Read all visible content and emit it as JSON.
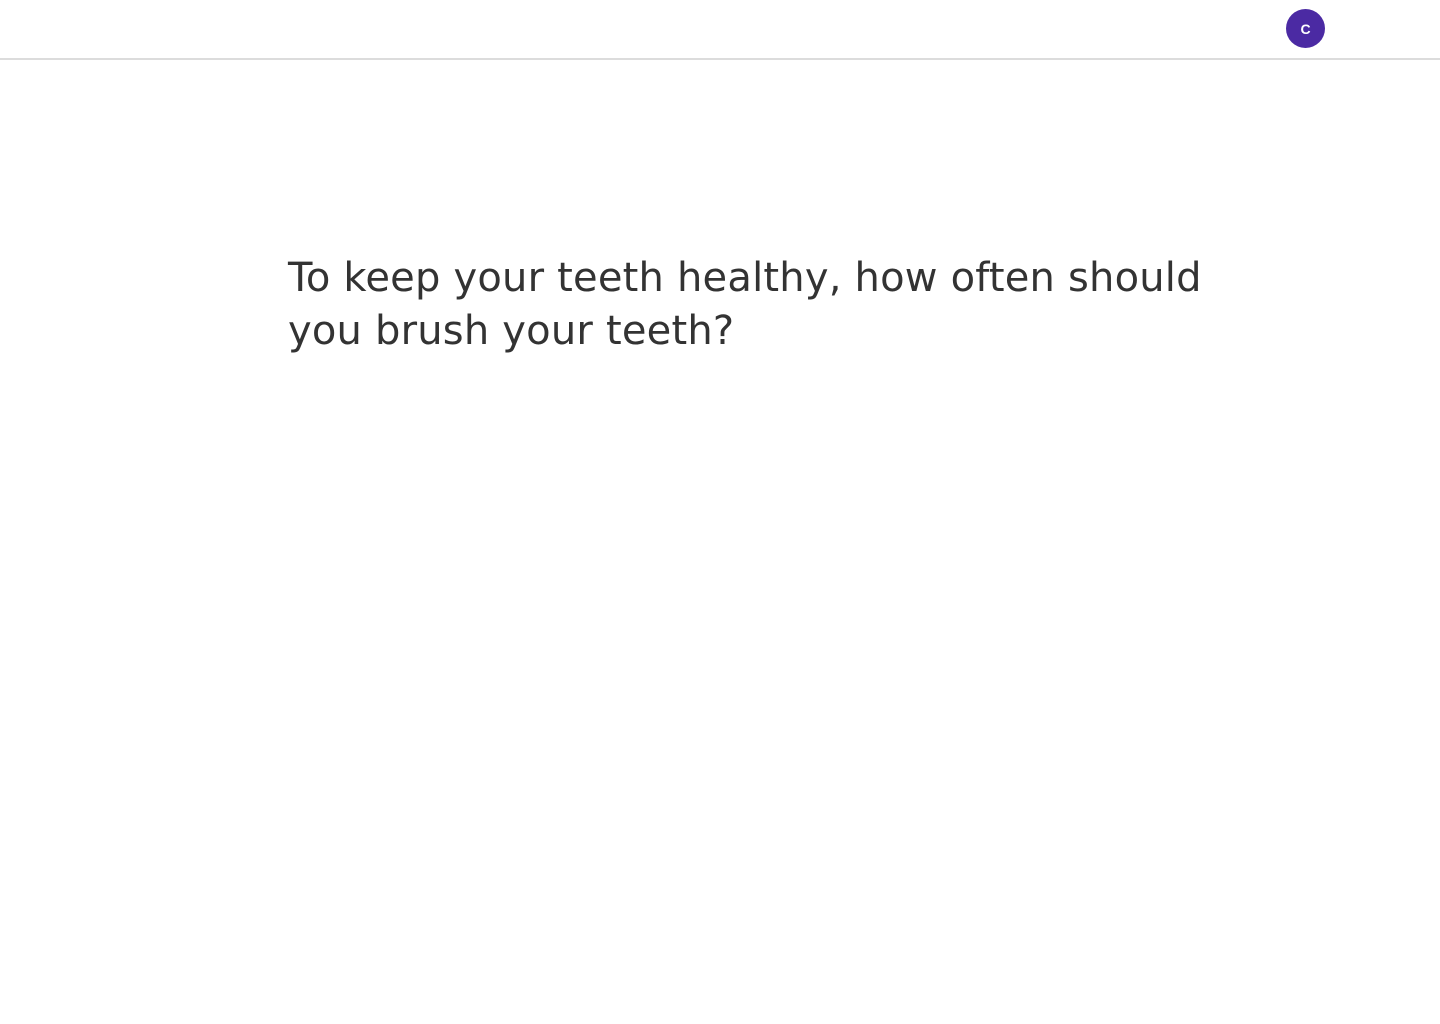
{
  "header": {
    "avatar": {
      "initial": "C",
      "color": "#4b2aa3"
    }
  },
  "main": {
    "question": "To keep your teeth healthy, how often should you brush your teeth?"
  }
}
